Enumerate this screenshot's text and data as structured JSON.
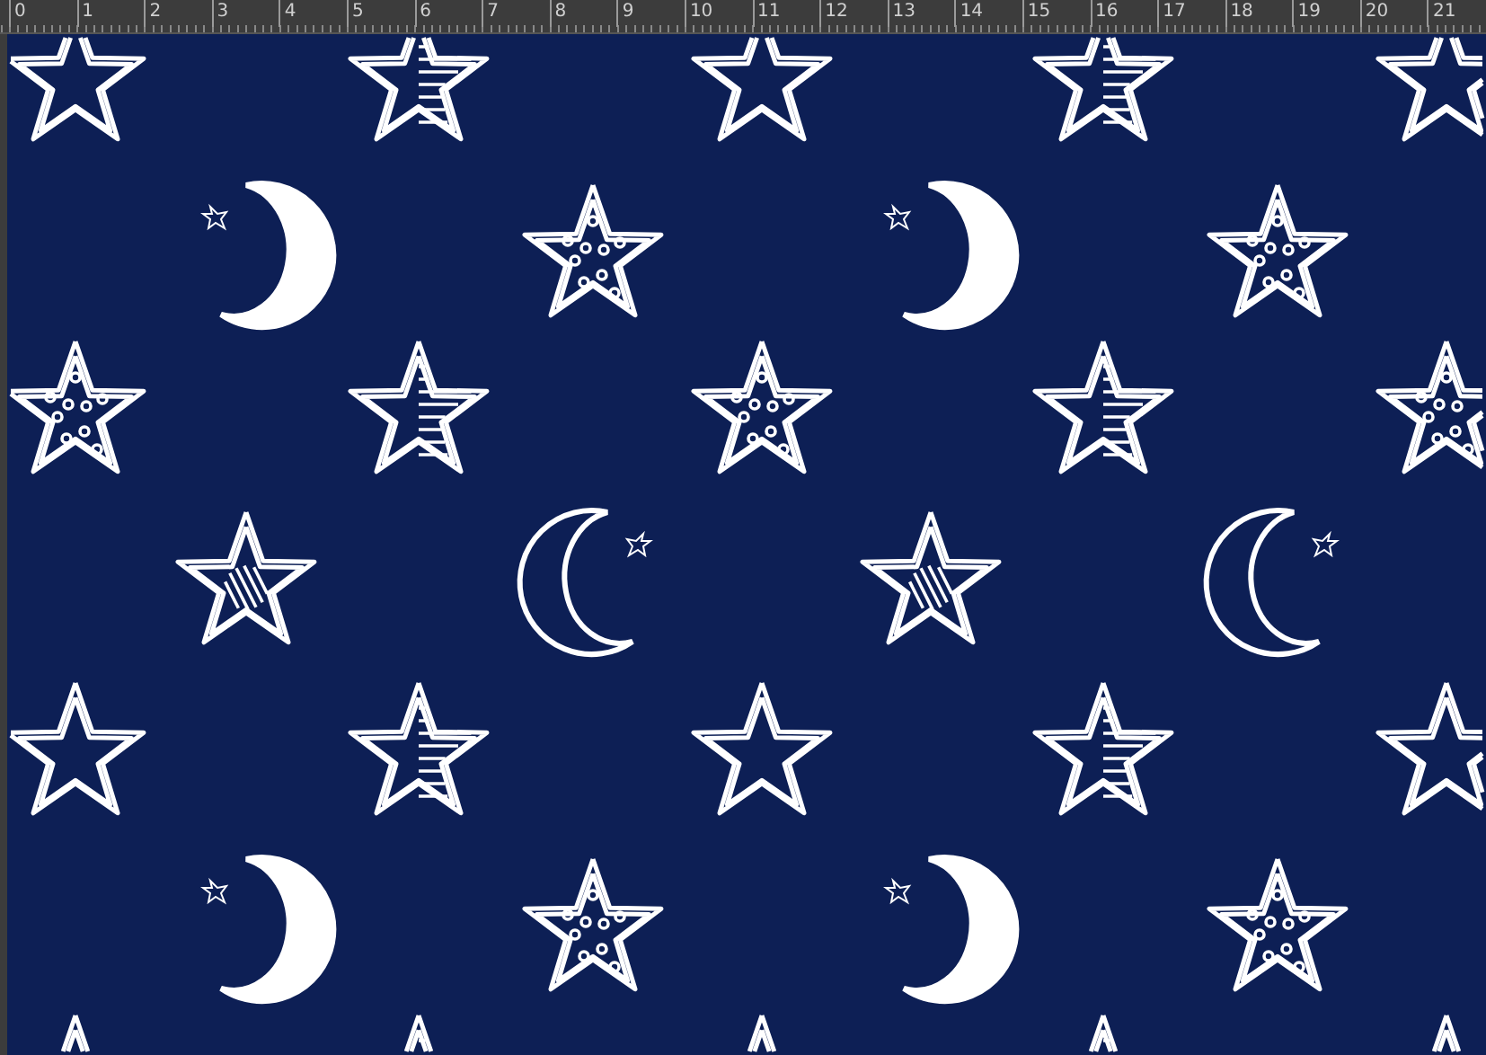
{
  "ruler": {
    "labels": [
      "0",
      "1",
      "2",
      "3",
      "4",
      "5",
      "6",
      "7",
      "8",
      "9",
      "10",
      "11",
      "12",
      "13",
      "14",
      "15",
      "16",
      "17",
      "18",
      "19",
      "20",
      "21"
    ]
  }
}
